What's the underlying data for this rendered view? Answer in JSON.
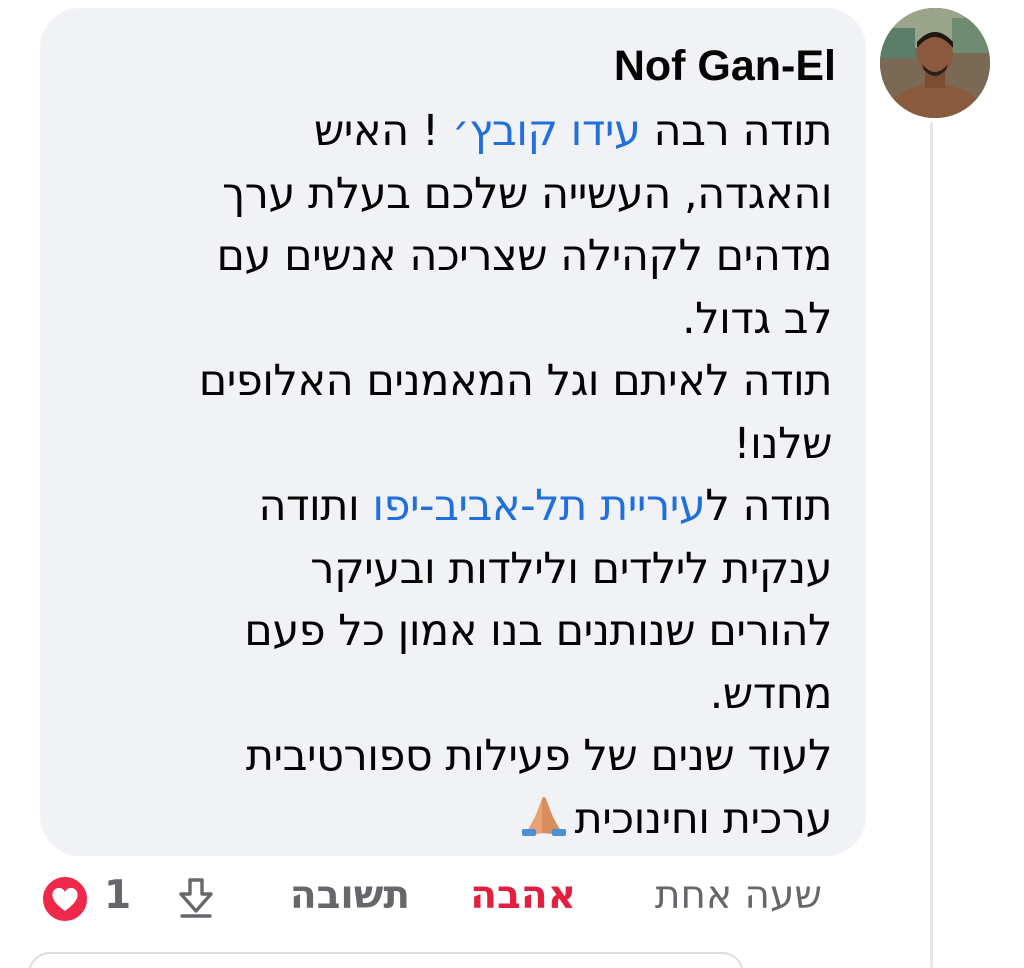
{
  "comment": {
    "author": "Nof Gan-El",
    "lines": [
      [
        {
          "text": "תודה רבה "
        },
        {
          "text": "עידו קובץ׳",
          "mention": true
        },
        {
          "text": " ! האיש"
        }
      ],
      [
        {
          "text": "והאגדה, העשייה שלכם בעלת ערך"
        }
      ],
      [
        {
          "text": "מדהים לקהילה שצריכה אנשים עם"
        }
      ],
      [
        {
          "text": "לב גדול."
        }
      ],
      [
        {
          "text": "תודה לאיתם וגל המאמנים האלופים"
        }
      ],
      [
        {
          "text": "שלנו!"
        }
      ],
      [
        {
          "text": "תודה ל"
        },
        {
          "text": "עיריית תל-אביב-יפו",
          "mention": true
        },
        {
          "text": " ותודה"
        }
      ],
      [
        {
          "text": "ענקית לילדים ולילדות ובעיקר"
        }
      ],
      [
        {
          "text": "להורים שנותנים בנו אמון כל פעם"
        }
      ],
      [
        {
          "text": "מחדש."
        }
      ],
      [
        {
          "text": "לעוד שנים של פעילות ספורטיבית"
        }
      ],
      [
        {
          "text": "ערכית וחינוכית"
        },
        {
          "emoji": "folded-hands-emoji"
        }
      ]
    ]
  },
  "actions": {
    "time": "שעה אחת",
    "love": "אהבה",
    "reply": "תשובה",
    "share_icon": "share-arrow-icon",
    "reaction_count": "1",
    "reaction_icon": "heart-reaction-icon"
  },
  "colors": {
    "mention": "#216fdb",
    "love": "#e41e3f",
    "muted": "#65676b",
    "bubble": "#f0f2f5",
    "heart": "#f0284a"
  }
}
